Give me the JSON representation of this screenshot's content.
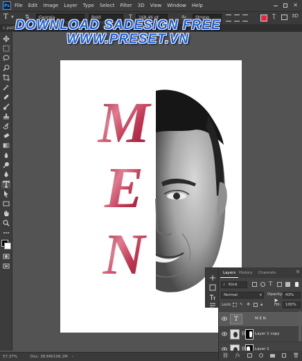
{
  "app": {
    "logo": "Ps"
  },
  "menu": [
    "File",
    "Edit",
    "Image",
    "Layer",
    "Type",
    "Select",
    "Filter",
    "3D",
    "View",
    "Window",
    "Help"
  ],
  "options": {
    "font_family": "Georgia",
    "font_style": "Bold",
    "font_size": "168.46 pt",
    "antialias": "Strong",
    "text_color": "#e8243c"
  },
  "doc_tab": "c.psd @ 57.1% (M E N, RGB/8)",
  "watermark": {
    "line1": "DOWNLOAD SADESIGN FREE",
    "line2": "WWW.PRESET.VN",
    "color": "#1e5fe0"
  },
  "canvas": {
    "letters": [
      "M",
      "E",
      "N"
    ],
    "text_color": "#c83a56"
  },
  "layers_panel": {
    "tabs": [
      "Layers",
      "History",
      "Channels"
    ],
    "filter_label": "Kind",
    "blend_mode": "Normal",
    "opacity_label": "Opacity:",
    "opacity_value": "43%",
    "lock_label": "Lock:",
    "fill_label": "Fill:",
    "fill_value": "100%",
    "layers": [
      {
        "name": "M E N",
        "type": "text",
        "selected": true
      },
      {
        "name": "Layer 1 copy",
        "type": "masked"
      },
      {
        "name": "Layer 1",
        "type": "masked"
      }
    ]
  },
  "status": {
    "zoom": "57.37%",
    "doc": "Doc: 38.6M/106.1M"
  }
}
